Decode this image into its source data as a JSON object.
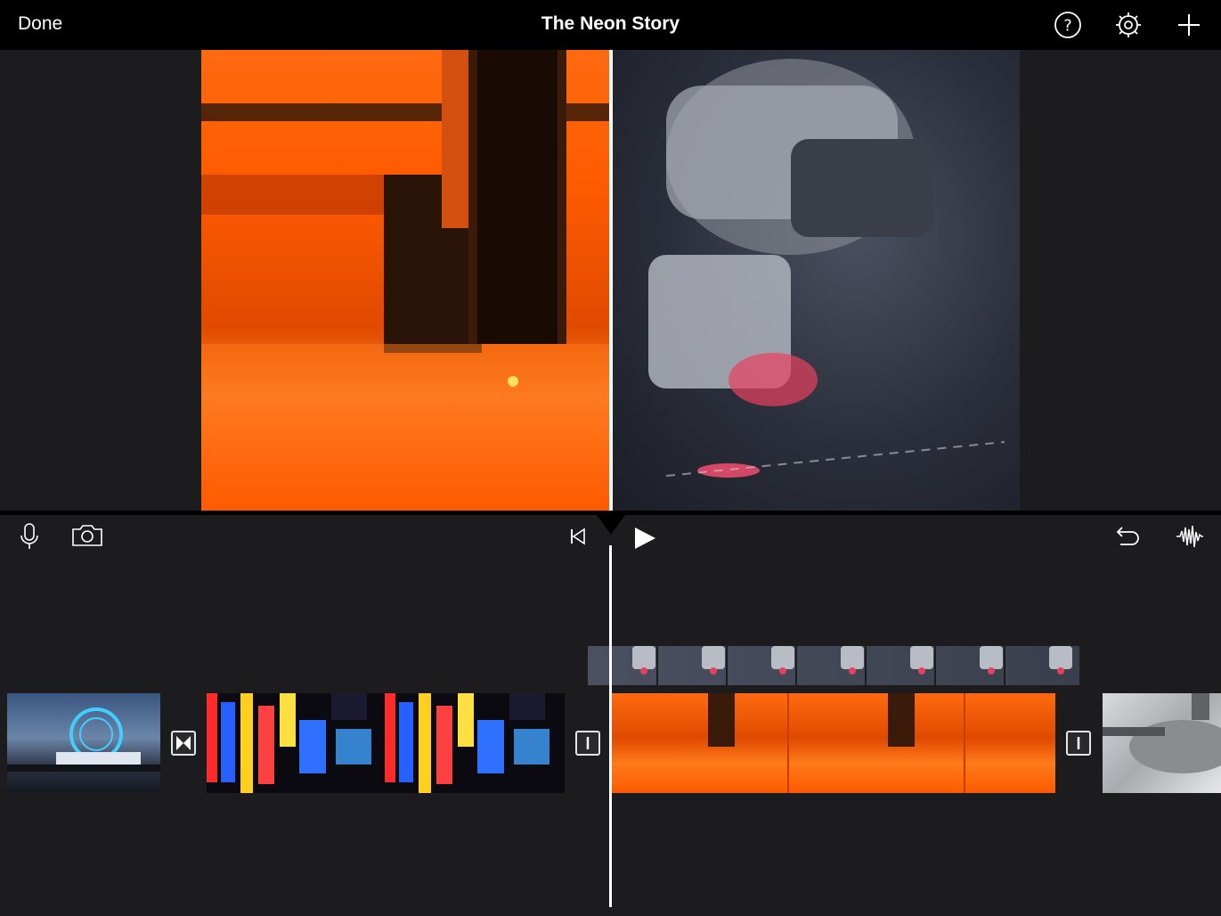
{
  "topbar": {
    "done_label": "Done",
    "title": "The Neon Story",
    "icons": [
      "help-icon",
      "settings-gear-icon",
      "add-plus-icon"
    ]
  },
  "viewer": {
    "split_view": true
  },
  "controls": {
    "left_icons": [
      "microphone-icon",
      "camera-icon"
    ],
    "center_icons": [
      "skip-to-start-icon",
      "play-icon"
    ],
    "right_icons": [
      "undo-icon",
      "audio-waveform-icon"
    ]
  },
  "timeline": {
    "clips": [
      "ferris-wheel-pier",
      "neon-street-signs",
      "laser-cutter-orange",
      "metal-machine"
    ],
    "overlay_clip": "laser-head-closeup",
    "transitions": [
      "cross-dissolve",
      "none",
      "none"
    ]
  },
  "colors": {
    "background": "#1c1c1e",
    "bar": "#000000",
    "accent": "#ff5a00"
  }
}
